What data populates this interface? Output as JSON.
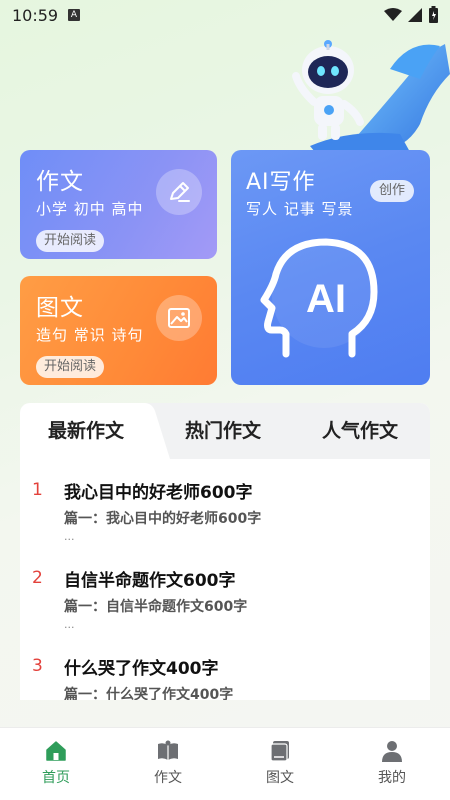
{
  "status_bar": {
    "time": "10:59",
    "notification_letter": "A"
  },
  "cards": {
    "zuowen": {
      "title": "作文",
      "subtitle": "小学 初中 高中",
      "button": "开始阅读",
      "icon": "pencil-icon"
    },
    "tuwen": {
      "title": "图文",
      "subtitle": "造句 常识 诗句",
      "button": "开始阅读",
      "icon": "picture-icon"
    },
    "ai": {
      "title": "AI写作",
      "subtitle": "写人 记事 写景",
      "button": "创作",
      "icon_text": "AI"
    }
  },
  "tabs": [
    {
      "label": "最新作文",
      "active": true
    },
    {
      "label": "热门作文",
      "active": false
    },
    {
      "label": "人气作文",
      "active": false
    }
  ],
  "articles": [
    {
      "num": "1",
      "title": "我心目中的好老师600字",
      "excerpt": "篇一：我心目中的好老师600字",
      "more": "..."
    },
    {
      "num": "2",
      "title": "自信半命题作文600字",
      "excerpt": "篇一：自信半命题作文600字",
      "more": "..."
    },
    {
      "num": "3",
      "title": "什么哭了作文400字",
      "excerpt": "篇一：什么哭了作文400字",
      "more": ""
    }
  ],
  "bottom_nav": [
    {
      "label": "首页",
      "icon": "home-icon",
      "active": true
    },
    {
      "label": "作文",
      "icon": "book-icon",
      "active": false
    },
    {
      "label": "图文",
      "icon": "album-icon",
      "active": false
    },
    {
      "label": "我的",
      "icon": "user-icon",
      "active": false
    }
  ],
  "colors": {
    "accent_green": "#2f9d5a",
    "card_blue": "#7f90f6",
    "card_orange": "#ff8a38",
    "card_ai_blue": "#5a88f2",
    "rank_red": "#e3413b"
  }
}
